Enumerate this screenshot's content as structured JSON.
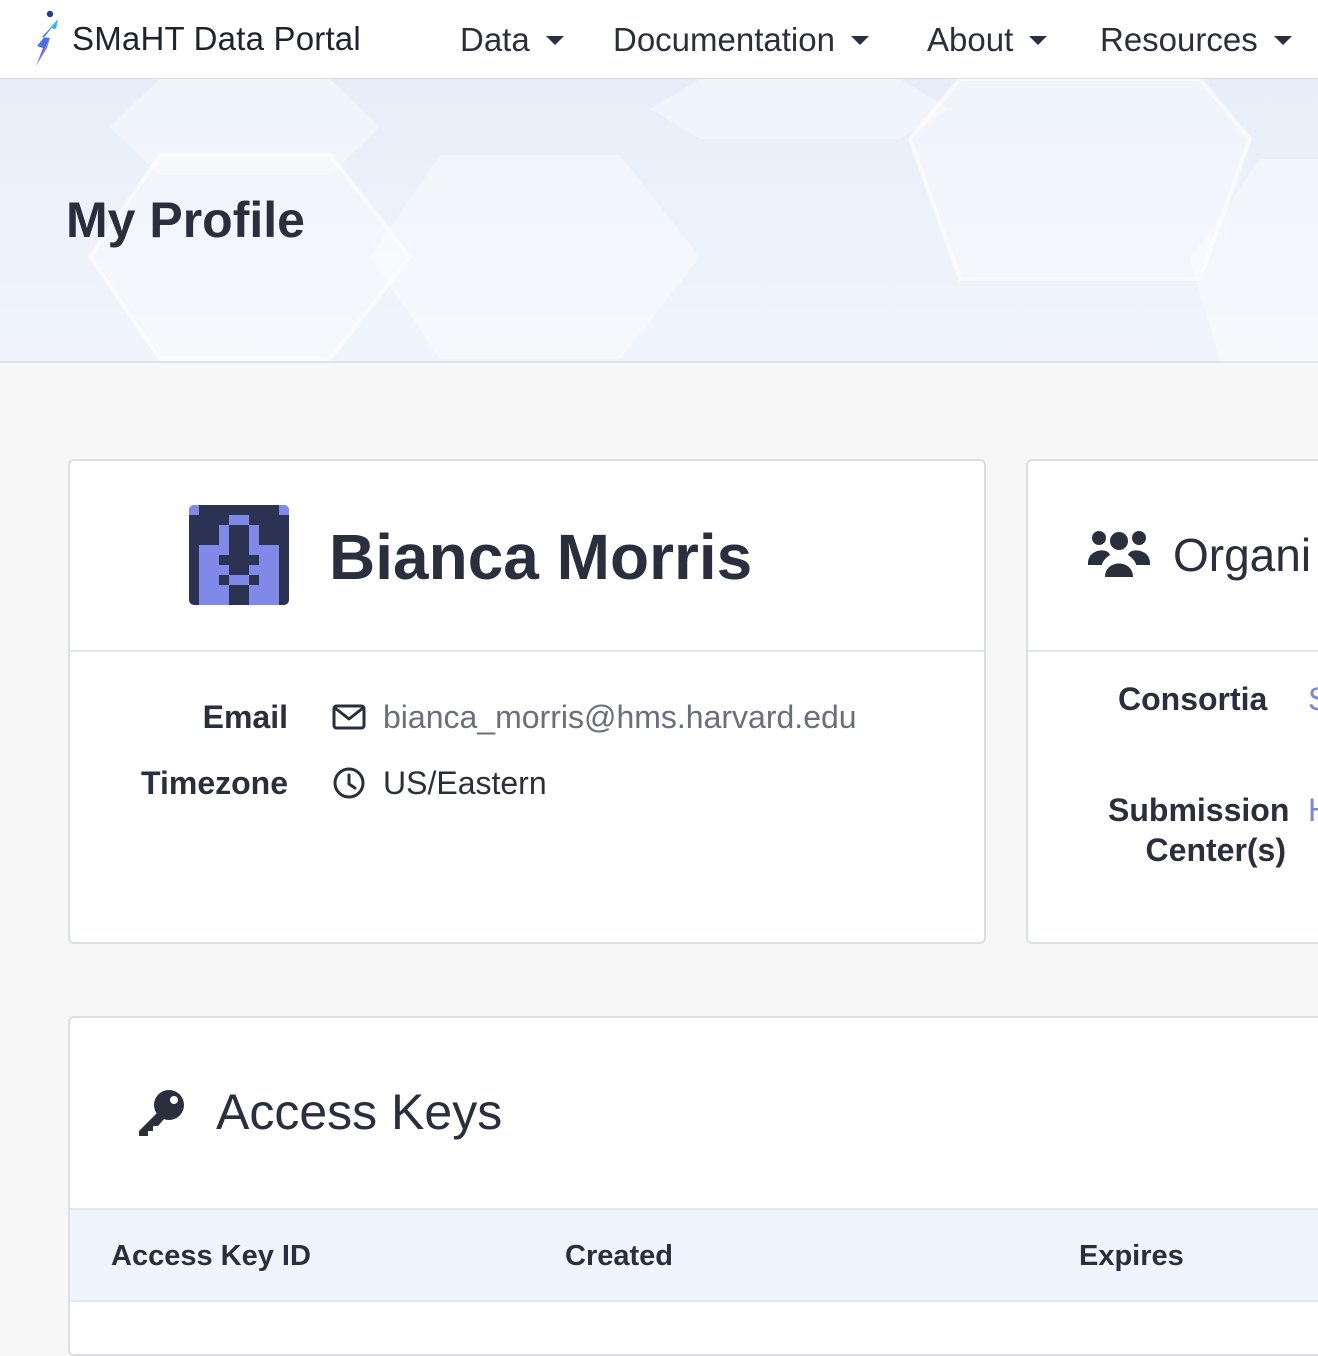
{
  "navbar": {
    "brand": "SMaHT Data Portal",
    "items": [
      {
        "label": "Data"
      },
      {
        "label": "Documentation"
      },
      {
        "label": "About"
      },
      {
        "label": "Resources"
      }
    ]
  },
  "hero": {
    "title": "My Profile"
  },
  "profile": {
    "name": "Bianca Morris",
    "email_label": "Email",
    "email": "bianca_morris@hms.harvard.edu",
    "timezone_label": "Timezone",
    "timezone": "US/Eastern"
  },
  "organizations": {
    "title": "Organi",
    "consortia_label": "Consortia",
    "consortia_value": "S",
    "submission_label_line1": "Submission",
    "submission_label_line2": "Center(s)",
    "submission_value": "H"
  },
  "access_keys": {
    "title": "Access Keys",
    "columns": [
      "Access Key ID",
      "Created",
      "Expires"
    ]
  },
  "colors": {
    "link": "#7c86d6",
    "avatar_dark": "#2b3252",
    "avatar_light": "#8088e8",
    "table_header_bg": "#f0f5fd"
  },
  "icons": {
    "email": "envelope-icon",
    "timezone": "clock-icon",
    "organizations": "users-icon",
    "access_keys": "key-icon",
    "dropdown": "caret-down-icon"
  }
}
